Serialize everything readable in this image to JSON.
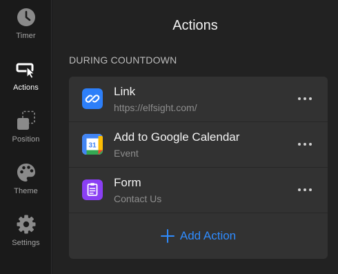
{
  "sidebar": {
    "items": [
      {
        "label": "Timer",
        "icon": "clock-icon",
        "active": false
      },
      {
        "label": "Actions",
        "icon": "cursor-click-icon",
        "active": true
      },
      {
        "label": "Position",
        "icon": "position-icon",
        "active": false
      },
      {
        "label": "Theme",
        "icon": "palette-icon",
        "active": false
      },
      {
        "label": "Settings",
        "icon": "gear-icon",
        "active": false
      }
    ]
  },
  "main": {
    "title": "Actions",
    "section_heading": "DURING COUNTDOWN",
    "actions": [
      {
        "title": "Link",
        "subtitle": "https://elfsight.com/",
        "icon": "link-icon",
        "icon_color": "#2d7ff9"
      },
      {
        "title": "Add to Google Calendar",
        "subtitle": "Event",
        "icon": "google-calendar-icon",
        "icon_color": "#ffffff",
        "calendar_day": "31"
      },
      {
        "title": "Form",
        "subtitle": "Contact Us",
        "icon": "form-icon",
        "icon_color": "#8a3ff3"
      }
    ],
    "add_action_label": "Add Action"
  },
  "colors": {
    "accent": "#2f8cff",
    "background": "#222222",
    "card": "#323232",
    "sidebar": "#1a1a1a"
  }
}
